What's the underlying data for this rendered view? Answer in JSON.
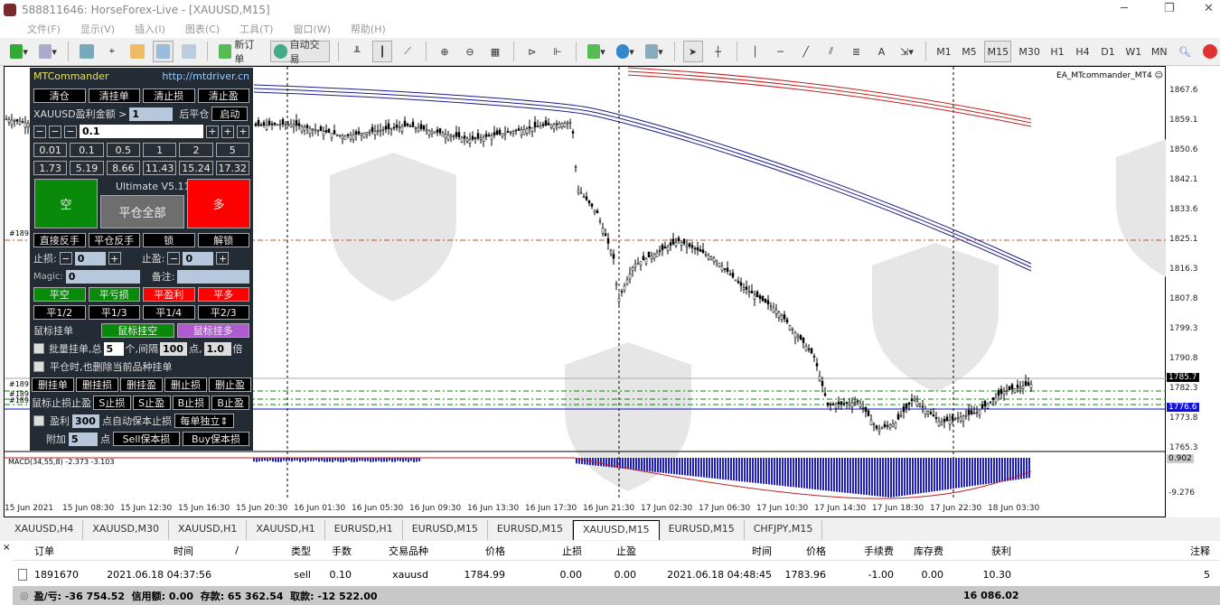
{
  "window": {
    "title": "588811646: HorseForex-Live - [XAUUSD,M15]"
  },
  "menu": [
    "文件(F)",
    "显示(V)",
    "插入(I)",
    "图表(C)",
    "工具(T)",
    "窗口(W)",
    "帮助(H)"
  ],
  "toolbar": {
    "new_order": "新订单",
    "auto_trading": "自动交易",
    "text_tool": "A",
    "timeframes": [
      "M1",
      "M5",
      "M15",
      "M30",
      "H1",
      "H4",
      "D1",
      "W1",
      "MN"
    ],
    "active_timeframe": "M15"
  },
  "chart": {
    "ea_label": "EA_MTcommander_MT4",
    "macd_label": "MACD(34,55,8) -2.373 -3.103",
    "order_tags": [
      "#189",
      "#189",
      "#189",
      "#189"
    ],
    "price_labels": [
      "1867.6",
      "1859.1",
      "1850.6",
      "1842.1",
      "1833.6",
      "1825.1",
      "1816.3",
      "1807.8",
      "1799.3",
      "1790.8",
      "1782.3",
      "1773.8",
      "1765.3"
    ],
    "ask_price": "1785.7",
    "bid_price": "1776.6",
    "macd_top": "0.902",
    "macd_bottom": "-9.276",
    "time_labels": [
      "15 Jun 2021",
      "15 Jun 08:30",
      "15 Jun 12:30",
      "15 Jun 16:30",
      "15 Jun 20:30",
      "16 Jun 01:30",
      "16 Jun 05:30",
      "16 Jun 09:30",
      "16 Jun 13:30",
      "16 Jun 17:30",
      "16 Jun 21:30",
      "17 Jun 02:30",
      "17 Jun 06:30",
      "17 Jun 10:30",
      "17 Jun 14:30",
      "17 Jun 18:30",
      "17 Jun 22:30",
      "18 Jun 03:30"
    ]
  },
  "panel": {
    "title": "MTCommander",
    "url": "http://mtdriver.cn",
    "row1": [
      "清仓",
      "清挂单",
      "清止损",
      "清止盈"
    ],
    "profit_label": "XAUUSD盈利金额 >",
    "profit_value": "1",
    "after_close": "后平仓",
    "start": "启动",
    "lot": "0.1",
    "minus": "−",
    "plus": "+",
    "lots": [
      "0.01",
      "0.1",
      "0.5",
      "1",
      "2",
      "5"
    ],
    "values": [
      "1.73",
      "5.19",
      "8.66",
      "11.43",
      "15.24",
      "17.32"
    ],
    "version": "Ultimate V5.11",
    "sell": "空",
    "close_all": "平仓全部",
    "buy": "多",
    "row_reverse": [
      "直接反手",
      "平仓反手",
      "锁",
      "解锁"
    ],
    "sl_label": "止损:",
    "sl_value": "0",
    "tp_label": "止盈:",
    "tp_value": "0",
    "magic_label": "Magic:",
    "magic_value": "0",
    "comment_label": "备注:",
    "close_row": [
      "平空",
      "平亏损",
      "平盈利",
      "平多"
    ],
    "partial_row": [
      "平1/2",
      "平1/3",
      "平1/4",
      "平2/3"
    ],
    "mouse_order": "鼠标挂单",
    "mouse_sell": "鼠标挂空",
    "mouse_buy": "鼠标挂多",
    "batch_label": "批量挂单,总",
    "batch_count": "5",
    "batch_mid": "个,间隔",
    "batch_interval": "100",
    "batch_point": "点,",
    "batch_mult": "1.0",
    "batch_times": "倍",
    "delete_on_close": "平仓时,也删除当前品种挂单",
    "delete_row": [
      "删挂单",
      "删挂损",
      "删挂盈",
      "删止损",
      "删止盈"
    ],
    "mouse_sltp": "鼠标止损止盈",
    "sltp_row": [
      "S止损",
      "S止盈",
      "B止损",
      "B止盈"
    ],
    "be_label": "盈利",
    "be_value": "300",
    "be_text": "点自动保本止损",
    "be_mode": "每单独立",
    "add_label": "附加",
    "add_value": "5",
    "add_point": "点",
    "sell_be": "Sell保本损",
    "buy_be": "Buy保本损"
  },
  "tabs": [
    "XAUUSD,H4",
    "XAUUSD,M30",
    "XAUUSD,H1",
    "XAUUSD,H1",
    "EURUSD,H1",
    "EURUSD,M15",
    "EURUSD,M15",
    "XAUUSD,M15",
    "EURUSD,M15",
    "CHFJPY,M15"
  ],
  "active_tab": 7,
  "table": {
    "headers": [
      "订单",
      "时间",
      "/",
      "类型",
      "手数",
      "交易品种",
      "价格",
      "止损",
      "止盈",
      "时间",
      "价格",
      "手续费",
      "库存费",
      "获利",
      "注释"
    ],
    "rows": [
      [
        "1891670",
        "2021.06.18 04:37:56",
        "sell",
        "0.10",
        "xauusd",
        "1784.99",
        "0.00",
        "0.00",
        "2021.06.18 04:48:45",
        "1783.96",
        "-1.00",
        "0.00",
        "10.30",
        "5"
      ]
    ],
    "summary": "盈/亏: -36 754.52  信用额: 0.00  存款: 65 362.54  取款: -12 522.00",
    "summary_profit": "16 086.02"
  }
}
